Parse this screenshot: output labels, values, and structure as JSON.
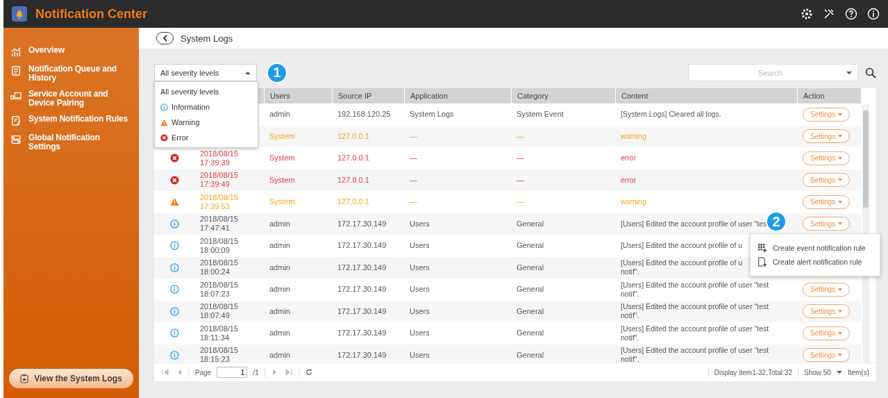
{
  "app": {
    "title": "Notification Center"
  },
  "sidebar": {
    "items": [
      {
        "label": "Overview",
        "kind": "chart",
        "selected": false
      },
      {
        "label": "Notification Queue and History",
        "kind": "queue",
        "selected": false
      },
      {
        "label": "Service Account and Device Pairing",
        "kind": "device",
        "selected": false
      },
      {
        "label": "System Notification Rules",
        "kind": "rules",
        "selected": false
      },
      {
        "label": "Global Notification Settings",
        "kind": "toggles",
        "selected": false
      }
    ],
    "footer_button": "View the System Logs"
  },
  "page": {
    "title": "System Logs"
  },
  "filter": {
    "value": "All severity levels",
    "expanded": true,
    "options": [
      {
        "label": "All severity levels",
        "kind": "all"
      },
      {
        "label": "Information",
        "kind": "info"
      },
      {
        "label": "Warning",
        "kind": "warning"
      },
      {
        "label": "Error",
        "kind": "error"
      }
    ]
  },
  "callouts": [
    "1",
    "2"
  ],
  "search": {
    "placeholder": "Search"
  },
  "table": {
    "columns": [
      "Users",
      "Source IP",
      "Application",
      "Category",
      "Content",
      "Action"
    ],
    "rows": [
      {
        "kind": "info",
        "icon_shown": false,
        "user": "admin",
        "source_ip": "192.168.120.25",
        "application": "System Logs",
        "category": "System Event",
        "content": "[System Logs] Cleared all logs.",
        "action": "Settings"
      },
      {
        "kind": "warning",
        "icon_shown": false,
        "user": "System",
        "source_ip": "127.0.0.1",
        "application": "—",
        "category": "—",
        "content": "warning",
        "action": "Settings"
      },
      {
        "kind": "error",
        "icon_shown": true,
        "date": "2018/08/15\n17:39:39",
        "user": "System",
        "source_ip": "127.0.0.1",
        "application": "—",
        "category": "—",
        "content": "error",
        "action": "Settings"
      },
      {
        "kind": "error",
        "icon_shown": true,
        "date": "2018/08/15\n17:39:49",
        "user": "System",
        "source_ip": "127.0.0.1",
        "application": "—",
        "category": "—",
        "content": "error",
        "action": "Settings"
      },
      {
        "kind": "warning",
        "icon_shown": true,
        "date": "2018/08/15\n17:39:53",
        "user": "System",
        "source_ip": "127.0.0.1",
        "application": "—",
        "category": "—",
        "content": "warning",
        "action": "Settings"
      },
      {
        "kind": "info",
        "icon_shown": true,
        "date": "2018/08/15\n17:47:41",
        "user": "admin",
        "source_ip": "172.17.30.149",
        "application": "Users",
        "category": "General",
        "content": "[Users] Edited the account profile of user \"tes",
        "action": "Settings"
      },
      {
        "kind": "info",
        "icon_shown": true,
        "date": "2018/08/15\n18:00:09",
        "user": "admin",
        "source_ip": "172.17.30.149",
        "application": "Users",
        "category": "General",
        "content": "[Users] Edited the account profile of u"
      },
      {
        "kind": "info",
        "icon_shown": true,
        "date": "2018/08/15\n18:00:24",
        "user": "admin",
        "source_ip": "172.17.30.149",
        "application": "Users",
        "category": "General",
        "content": "[Users] Edited the account profile of u\nnotif\"."
      },
      {
        "kind": "info",
        "icon_shown": true,
        "date": "2018/08/15\n18:07:23",
        "user": "admin",
        "source_ip": "172.17.30.149",
        "application": "Users",
        "category": "General",
        "content": "[Users] Edited the account profile of user \"test\nnotif\".",
        "action": "Settings"
      },
      {
        "kind": "info",
        "icon_shown": true,
        "date": "2018/08/15\n18:07:49",
        "user": "admin",
        "source_ip": "172.17.30.149",
        "application": "Users",
        "category": "General",
        "content": "[Users] Edited the account profile of user \"test\nnotif\".",
        "action": "Settings"
      },
      {
        "kind": "info",
        "icon_shown": true,
        "date": "2018/08/15\n18:11:34",
        "user": "admin",
        "source_ip": "172.17.30.149",
        "application": "Users",
        "category": "General",
        "content": "[Users] Edited the account profile of user \"test\nnotif\".",
        "action": "Settings"
      },
      {
        "kind": "info",
        "icon_shown": true,
        "date": "2018/08/15\n18:15:23",
        "user": "admin",
        "source_ip": "172.17.30.149",
        "application": "Users",
        "category": "General",
        "content": "[Users] Edited the account profile of user \"test\nnotif\".",
        "action": "Settings"
      }
    ]
  },
  "context_menu": {
    "items": [
      {
        "label": "Create event notification rule",
        "kind": "event"
      },
      {
        "label": "Create alert notification rule",
        "kind": "alert"
      }
    ]
  },
  "pagination": {
    "page_label": "Page",
    "page": "1",
    "total_pages": "/1",
    "summary": "Display item1-32,Total:32",
    "show": "Show 50",
    "unit": "Item(s)"
  }
}
